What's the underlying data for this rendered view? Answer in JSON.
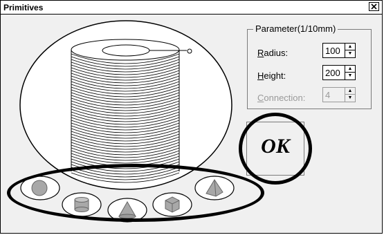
{
  "window": {
    "title": "Primitives"
  },
  "parameter": {
    "legend": "Parameter(1/10mm)",
    "radius": {
      "label_u": "R",
      "label_rest": "adius:",
      "value": "100"
    },
    "height": {
      "label_u": "H",
      "label_rest": "eight:",
      "value": "200"
    },
    "connection": {
      "label_u": "C",
      "label_rest": "onnection:",
      "value": "4",
      "enabled": false
    }
  },
  "ok_button": {
    "label": "OK"
  },
  "preview": {
    "shape": "cylinder"
  },
  "shape_buttons": [
    {
      "name": "sphere",
      "icon": "sphere-icon"
    },
    {
      "name": "cylinder",
      "icon": "cylinder-icon"
    },
    {
      "name": "cone",
      "icon": "cone-icon"
    },
    {
      "name": "cube",
      "icon": "cube-icon"
    },
    {
      "name": "pyramid",
      "icon": "pyramid-icon"
    }
  ],
  "colors": {
    "dialog_bg": "#f0f0f0",
    "border": "#000000",
    "disabled_text": "#9a9a9a",
    "shape_fill": "#a8a8a8"
  }
}
